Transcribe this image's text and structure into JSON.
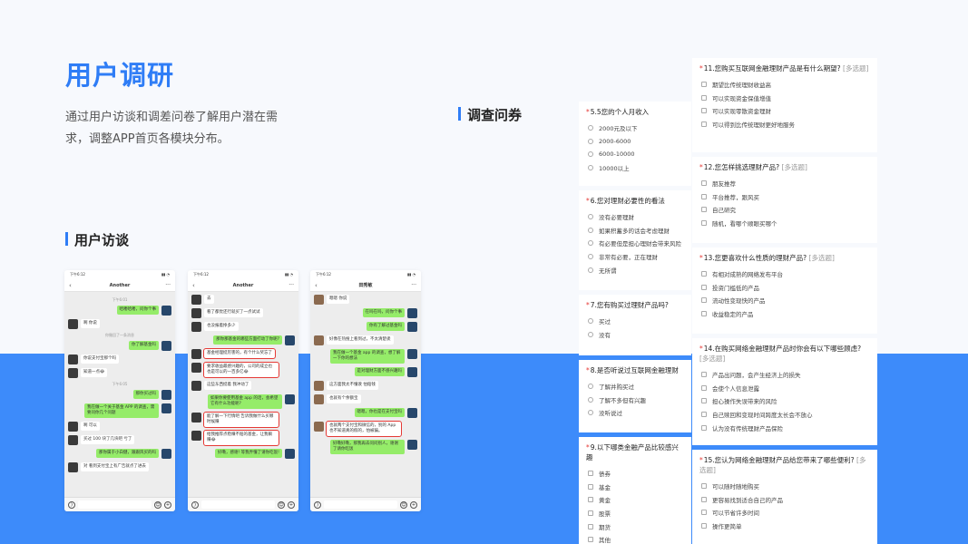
{
  "title": "用户调研",
  "description": "通过用户访谈和调差问卷了解用户潜在需求，调整APP首页各模块分布。",
  "sections": {
    "interview": "用户访谈",
    "survey": "调查问券"
  },
  "phones": [
    {
      "status_time": "下午6:12",
      "status_right": "▮▮ ◔",
      "contact": "Another",
      "messages": [
        {
          "type": "ts",
          "text": "下午6:01"
        },
        {
          "side": "me",
          "text": "哈喽哈喽，问你个事"
        },
        {
          "side": "them",
          "text": "啊 你说"
        },
        {
          "type": "ts",
          "text": "你撤回了一条消息"
        },
        {
          "side": "me",
          "text": "你了解基金吗"
        },
        {
          "side": "them",
          "text": "你说支付宝那个吗"
        },
        {
          "side": "them",
          "text": "知道一点😂"
        },
        {
          "type": "ts",
          "text": "下午6:05"
        },
        {
          "side": "me",
          "text": "那你买过吗"
        },
        {
          "side": "me",
          "text": "我在做一个关于基金 APP 的调查，需要问你几个问题"
        },
        {
          "side": "them",
          "text": "啊 可以"
        },
        {
          "side": "them",
          "text": "买过 100 块了几块吧 亏了"
        },
        {
          "side": "me",
          "text": "那你属于小白健，跟跟风买的吗"
        },
        {
          "side": "them",
          "text": "对 看到支付宝上有广告就点了进去"
        }
      ]
    },
    {
      "status_time": "下午6:12",
      "status_right": "▮▮ ◔",
      "contact": "Another",
      "messages": [
        {
          "side": "them",
          "text": "去"
        },
        {
          "side": "them",
          "text": "看了都觉还行就买了一点试试"
        },
        {
          "side": "them",
          "text": "也没报着挣多少"
        },
        {
          "side": "me",
          "text": "那你那基金的哪些方面打动了你呢?"
        },
        {
          "side": "them",
          "text": "基金经理挺厉害的，有个什么奖忘了",
          "red": true
        },
        {
          "side": "them",
          "text": "要求收益最感兴趣的，公司的成立也也是可以的一百多亿😂",
          "red": true
        },
        {
          "side": "them",
          "text": "这些东西挺着 我冲动了"
        },
        {
          "side": "me",
          "text": "如果你要使用基金 app 的话，会希望它有什么功能呢?"
        },
        {
          "side": "them",
          "text": "能了解一下行情吧 告诉我做什么买哪时候赚",
          "red": true
        },
        {
          "side": "them",
          "text": "给我推荐点稳赚不赔的基金，让我躺赚😂",
          "red": true
        },
        {
          "side": "me",
          "text": "好嘞，感谢! 等我弄懂了请你吃饭!"
        }
      ]
    },
    {
      "status_time": "下午6:12",
      "status_right": "▮▮ ◔",
      "contact": "田秀敏",
      "messages": [
        {
          "side": "them",
          "text": "嗯嗯 你说"
        },
        {
          "side": "me",
          "text": "在吗在吗，问你个事"
        },
        {
          "side": "me",
          "text": "你有了解过基金吗"
        },
        {
          "side": "them",
          "text": "好像在热搜上看到过，不太清楚诶"
        },
        {
          "side": "me",
          "text": "我在做一个基金 app 的调查，想了解一下你的想法"
        },
        {
          "side": "me",
          "text": "是对理财方面不感兴趣吗"
        },
        {
          "side": "them",
          "text": "这方面我太不懂诶 怕赔钱"
        },
        {
          "side": "them",
          "text": "也就有个余额宝"
        },
        {
          "side": "me",
          "text": "嗯嗯，你也是在支付宝吗"
        },
        {
          "side": "them",
          "text": "也就两个支付宝和微信的，别的 App 也不知道真的假的，怕被骗。",
          "red": true
        },
        {
          "side": "me",
          "text": "好嘞好嘞，那我再去问问别人，谢谢了请你吃饭"
        }
      ]
    }
  ],
  "survey_left": [
    {
      "q": "5.5您的个人月收入",
      "type": "radio",
      "options": [
        "2000元及以下",
        "2000-6000",
        "6000-10000",
        "10000以上"
      ]
    },
    {
      "q": "6.您对理财必要性的看法",
      "type": "radio",
      "options": [
        "没有必要理财",
        "如果积蓄多的话会考虑理财",
        "有必要但是担心理财会带来风险",
        "非常有必要，正在理财",
        "无所谓"
      ]
    },
    {
      "q": "7.您有购买过理财产品吗?",
      "type": "radio",
      "options": [
        "买过",
        "没有"
      ]
    },
    {
      "q": "8.是否听说过互联网金融理财",
      "type": "radio",
      "options": [
        "了解并购买过",
        "了解不多但有兴趣",
        "没听说过"
      ]
    },
    {
      "q": "9.以下哪类金融产品比较感兴趣",
      "type": "check",
      "options": [
        "债券",
        "基金",
        "黄金",
        "股票",
        "期货",
        "其他"
      ]
    }
  ],
  "survey_right": [
    {
      "q": "11.您购买互联网金融理财产品是有什么期望?",
      "tag": "[多选题]",
      "options": [
        "期望比传统理财收益高",
        "可以实现资金保值增值",
        "可以实现零散资金理财",
        "可以得到比传统理财更好地服务"
      ]
    },
    {
      "q": "12.您怎样挑选理财产品?",
      "tag": "[多选题]",
      "options": [
        "朋友推荐",
        "平台推荐，跟风买",
        "自己研究",
        "随机，看哪个顺眼买哪个"
      ]
    },
    {
      "q": "13.您更喜欢什么性质的理财产品?",
      "tag": "[多选题]",
      "options": [
        "有相对成熟的网络发布平台",
        "投资门槛低的产品",
        "流动性变现快的产品",
        "收益稳定的产品"
      ]
    },
    {
      "q": "14.在购买网络金融理财产品时你会有以下哪些顾虑?",
      "tag": "[多选题]",
      "options": [
        "产品出问题，会产生经济上的损失",
        "会使个人信息泄露",
        "担心操作失误带来的风险",
        "自己赎回和变现时间跨度太长会不放心",
        "认为没有传统理财产品保险"
      ]
    },
    {
      "q": "15.您认为网络金融理财产品给您带来了哪些便利?",
      "tag": "[多选题]",
      "options": [
        "可以随时随地购买",
        "更容易找到适合自己的产品",
        "可以节省许多时间",
        "操作更简单"
      ]
    }
  ],
  "colors": {
    "accent": "#2f7df6",
    "bubble_me": "#95ec69",
    "highlight": "#e53935",
    "blue_band": "#3d8bfa"
  }
}
